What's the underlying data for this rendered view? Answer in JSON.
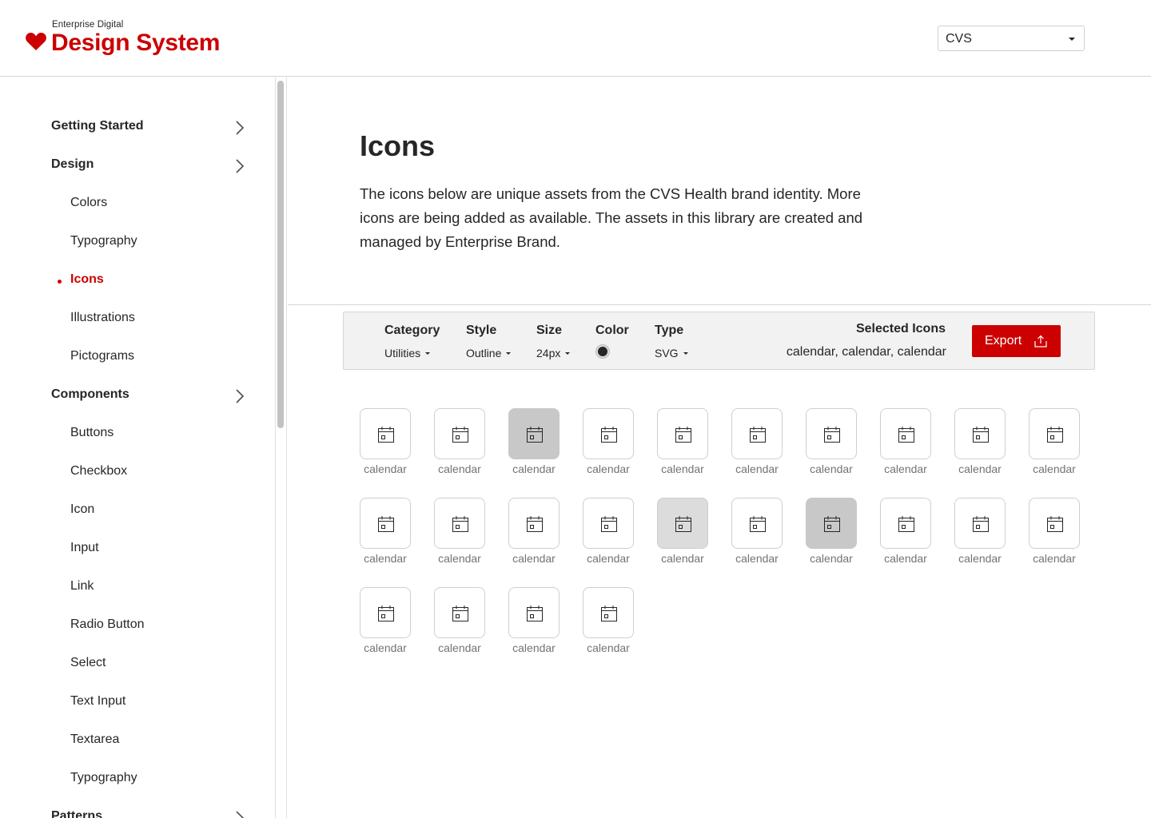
{
  "header": {
    "logo_small": "Enterprise Digital",
    "logo_big": "Design System",
    "brand_select": {
      "value": "CVS"
    }
  },
  "sidebar": {
    "items": [
      {
        "label": "Getting Started",
        "kind": "section",
        "expandable": true
      },
      {
        "label": "Design",
        "kind": "section",
        "expandable": true
      },
      {
        "label": "Colors",
        "kind": "sub"
      },
      {
        "label": "Typography",
        "kind": "sub"
      },
      {
        "label": "Icons",
        "kind": "sub",
        "active": true
      },
      {
        "label": "Illustrations",
        "kind": "sub"
      },
      {
        "label": "Pictograms",
        "kind": "sub"
      },
      {
        "label": "Components",
        "kind": "section",
        "expandable": true
      },
      {
        "label": "Buttons",
        "kind": "sub"
      },
      {
        "label": "Checkbox",
        "kind": "sub"
      },
      {
        "label": "Icon",
        "kind": "sub"
      },
      {
        "label": "Input",
        "kind": "sub"
      },
      {
        "label": "Link",
        "kind": "sub"
      },
      {
        "label": "Radio Button",
        "kind": "sub"
      },
      {
        "label": "Select",
        "kind": "sub"
      },
      {
        "label": "Text Input",
        "kind": "sub"
      },
      {
        "label": "Textarea",
        "kind": "sub"
      },
      {
        "label": "Typography",
        "kind": "sub"
      },
      {
        "label": "Patterns",
        "kind": "section",
        "expandable": true
      }
    ]
  },
  "main": {
    "title": "Icons",
    "description": "The icons below are unique assets from the CVS Health brand identity. More icons are being added as available. The assets in this library are created and managed by Enterprise Brand."
  },
  "toolbar": {
    "filters": [
      {
        "label": "Category",
        "value": "Utilities"
      },
      {
        "label": "Style",
        "value": "Outline"
      },
      {
        "label": "Size",
        "value": "24px"
      },
      {
        "label": "Color",
        "value": ""
      },
      {
        "label": "Type",
        "value": "SVG"
      }
    ],
    "color_value": "#262626",
    "selected_title": "Selected Icons",
    "selected_list": "calendar, calendar, calendar",
    "export_label": "Export"
  },
  "icons": {
    "items": [
      {
        "label": "calendar",
        "state": "none"
      },
      {
        "label": "calendar",
        "state": "none"
      },
      {
        "label": "calendar",
        "state": "selected"
      },
      {
        "label": "calendar",
        "state": "none"
      },
      {
        "label": "calendar",
        "state": "none"
      },
      {
        "label": "calendar",
        "state": "none"
      },
      {
        "label": "calendar",
        "state": "none"
      },
      {
        "label": "calendar",
        "state": "none"
      },
      {
        "label": "calendar",
        "state": "none"
      },
      {
        "label": "calendar",
        "state": "none"
      },
      {
        "label": "calendar",
        "state": "none"
      },
      {
        "label": "calendar",
        "state": "none"
      },
      {
        "label": "calendar",
        "state": "none"
      },
      {
        "label": "calendar",
        "state": "none"
      },
      {
        "label": "calendar",
        "state": "hover"
      },
      {
        "label": "calendar",
        "state": "none"
      },
      {
        "label": "calendar",
        "state": "selected"
      },
      {
        "label": "calendar",
        "state": "none"
      },
      {
        "label": "calendar",
        "state": "none"
      },
      {
        "label": "calendar",
        "state": "none"
      },
      {
        "label": "calendar",
        "state": "none"
      },
      {
        "label": "calendar",
        "state": "none"
      },
      {
        "label": "calendar",
        "state": "none"
      },
      {
        "label": "calendar",
        "state": "none"
      }
    ],
    "icon_name": "calendar-icon"
  },
  "colors": {
    "brand_red": "#cc0000",
    "text": "#262626",
    "muted": "#737373"
  }
}
